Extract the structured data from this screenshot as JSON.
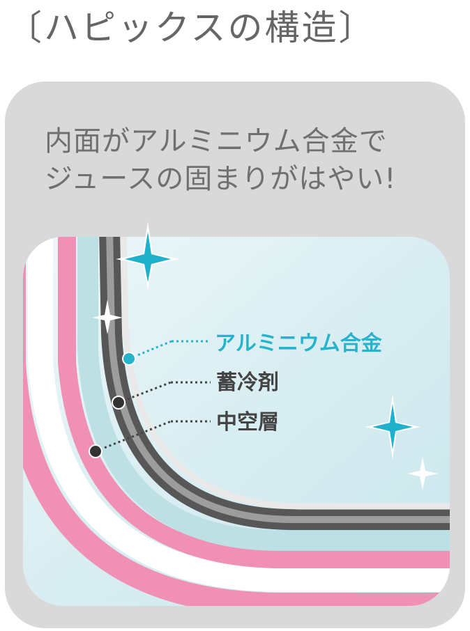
{
  "title": "〔ハピックスの構造〕",
  "headline": {
    "line1": "内面がアルミニウム合金で",
    "line2": "ジュースの固まりがはやい!"
  },
  "layers": {
    "alloy": {
      "label": "アルミニウム合金",
      "color": "#27b3cc"
    },
    "coolant": {
      "label": "蓄冷剤",
      "color": "#444444"
    },
    "hollow": {
      "label": "中空層",
      "color": "#444444"
    }
  },
  "colors": {
    "panel": "#d9d9d9",
    "pink": "#f090b4",
    "light_blue": "#bde0e5",
    "inner": "#dcedf1",
    "sparkle": "#1fb0cc"
  },
  "icons": [
    "sparkle-icon"
  ]
}
